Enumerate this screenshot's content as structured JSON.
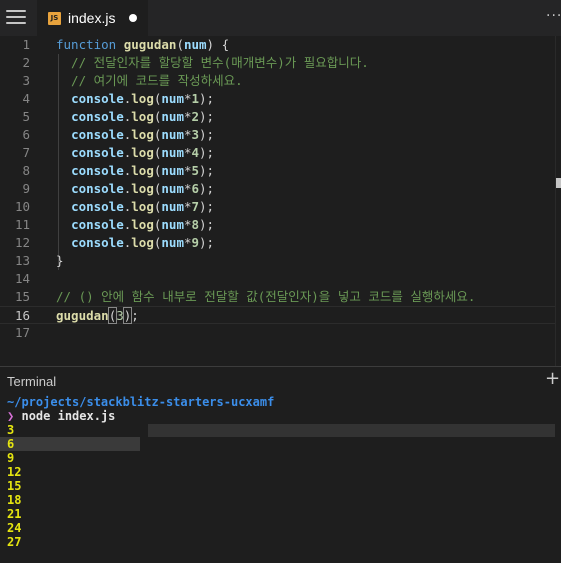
{
  "tab": {
    "filename": "index.js",
    "icon_label": "JS",
    "modified": true
  },
  "editor": {
    "lines": [
      {
        "n": "1",
        "tokens": [
          {
            "t": "function",
            "c": "kw"
          },
          {
            "t": " ",
            "c": "pl"
          },
          {
            "t": "gugudan",
            "c": "fn bold"
          },
          {
            "t": "(",
            "c": "pl"
          },
          {
            "t": "num",
            "c": "var bold"
          },
          {
            "t": ") {",
            "c": "pl"
          }
        ]
      },
      {
        "n": "2",
        "tokens": [
          {
            "t": "  // 전달인자를 할당할 변수(매개변수)가 필요합니다.",
            "c": "cmt"
          }
        ]
      },
      {
        "n": "3",
        "tokens": [
          {
            "t": "  // 여기에 코드를 작성하세요.",
            "c": "cmt"
          }
        ]
      },
      {
        "n": "4",
        "tokens": [
          {
            "t": "  ",
            "c": "pl"
          },
          {
            "t": "console",
            "c": "var bold"
          },
          {
            "t": ".",
            "c": "pl"
          },
          {
            "t": "log",
            "c": "fn bold"
          },
          {
            "t": "(",
            "c": "pl"
          },
          {
            "t": "num",
            "c": "var bold"
          },
          {
            "t": "*",
            "c": "pl"
          },
          {
            "t": "1",
            "c": "num bold"
          },
          {
            "t": ");",
            "c": "pl"
          }
        ]
      },
      {
        "n": "5",
        "tokens": [
          {
            "t": "  ",
            "c": "pl"
          },
          {
            "t": "console",
            "c": "var bold"
          },
          {
            "t": ".",
            "c": "pl"
          },
          {
            "t": "log",
            "c": "fn bold"
          },
          {
            "t": "(",
            "c": "pl"
          },
          {
            "t": "num",
            "c": "var bold"
          },
          {
            "t": "*",
            "c": "pl"
          },
          {
            "t": "2",
            "c": "num bold"
          },
          {
            "t": ");",
            "c": "pl"
          }
        ]
      },
      {
        "n": "6",
        "tokens": [
          {
            "t": "  ",
            "c": "pl"
          },
          {
            "t": "console",
            "c": "var bold"
          },
          {
            "t": ".",
            "c": "pl"
          },
          {
            "t": "log",
            "c": "fn bold"
          },
          {
            "t": "(",
            "c": "pl"
          },
          {
            "t": "num",
            "c": "var bold"
          },
          {
            "t": "*",
            "c": "pl"
          },
          {
            "t": "3",
            "c": "num bold"
          },
          {
            "t": ");",
            "c": "pl"
          }
        ]
      },
      {
        "n": "7",
        "tokens": [
          {
            "t": "  ",
            "c": "pl"
          },
          {
            "t": "console",
            "c": "var bold"
          },
          {
            "t": ".",
            "c": "pl"
          },
          {
            "t": "log",
            "c": "fn bold"
          },
          {
            "t": "(",
            "c": "pl"
          },
          {
            "t": "num",
            "c": "var bold"
          },
          {
            "t": "*",
            "c": "pl"
          },
          {
            "t": "4",
            "c": "num bold"
          },
          {
            "t": ");",
            "c": "pl"
          }
        ]
      },
      {
        "n": "8",
        "tokens": [
          {
            "t": "  ",
            "c": "pl"
          },
          {
            "t": "console",
            "c": "var bold"
          },
          {
            "t": ".",
            "c": "pl"
          },
          {
            "t": "log",
            "c": "fn bold"
          },
          {
            "t": "(",
            "c": "pl"
          },
          {
            "t": "num",
            "c": "var bold"
          },
          {
            "t": "*",
            "c": "pl"
          },
          {
            "t": "5",
            "c": "num bold"
          },
          {
            "t": ");",
            "c": "pl"
          }
        ]
      },
      {
        "n": "9",
        "tokens": [
          {
            "t": "  ",
            "c": "pl"
          },
          {
            "t": "console",
            "c": "var bold"
          },
          {
            "t": ".",
            "c": "pl"
          },
          {
            "t": "log",
            "c": "fn bold"
          },
          {
            "t": "(",
            "c": "pl"
          },
          {
            "t": "num",
            "c": "var bold"
          },
          {
            "t": "*",
            "c": "pl"
          },
          {
            "t": "6",
            "c": "num bold"
          },
          {
            "t": ");",
            "c": "pl"
          }
        ]
      },
      {
        "n": "10",
        "tokens": [
          {
            "t": "  ",
            "c": "pl"
          },
          {
            "t": "console",
            "c": "var bold"
          },
          {
            "t": ".",
            "c": "pl"
          },
          {
            "t": "log",
            "c": "fn bold"
          },
          {
            "t": "(",
            "c": "pl"
          },
          {
            "t": "num",
            "c": "var bold"
          },
          {
            "t": "*",
            "c": "pl"
          },
          {
            "t": "7",
            "c": "num bold"
          },
          {
            "t": ");",
            "c": "pl"
          }
        ]
      },
      {
        "n": "11",
        "tokens": [
          {
            "t": "  ",
            "c": "pl"
          },
          {
            "t": "console",
            "c": "var bold"
          },
          {
            "t": ".",
            "c": "pl"
          },
          {
            "t": "log",
            "c": "fn bold"
          },
          {
            "t": "(",
            "c": "pl"
          },
          {
            "t": "num",
            "c": "var bold"
          },
          {
            "t": "*",
            "c": "pl"
          },
          {
            "t": "8",
            "c": "num bold"
          },
          {
            "t": ");",
            "c": "pl"
          }
        ]
      },
      {
        "n": "12",
        "tokens": [
          {
            "t": "  ",
            "c": "pl"
          },
          {
            "t": "console",
            "c": "var bold"
          },
          {
            "t": ".",
            "c": "pl"
          },
          {
            "t": "log",
            "c": "fn bold"
          },
          {
            "t": "(",
            "c": "pl"
          },
          {
            "t": "num",
            "c": "var bold"
          },
          {
            "t": "*",
            "c": "pl"
          },
          {
            "t": "9",
            "c": "num bold"
          },
          {
            "t": ");",
            "c": "pl"
          }
        ]
      },
      {
        "n": "13",
        "tokens": [
          {
            "t": "}",
            "c": "pl"
          }
        ]
      },
      {
        "n": "14",
        "tokens": []
      },
      {
        "n": "15",
        "tokens": [
          {
            "t": "// () 안에 함수 내부로 전달할 값(전달인자)을 넣고 코드를 실행하세요.",
            "c": "cmt"
          }
        ]
      },
      {
        "n": "16",
        "active": true,
        "tokens": [
          {
            "t": "gugudan",
            "c": "fn bold"
          },
          {
            "t": "(",
            "c": "pl bracket-match"
          },
          {
            "t": "3",
            "c": "num"
          },
          {
            "t": ")",
            "c": "pl bracket-match"
          },
          {
            "t": ";",
            "c": "pl"
          }
        ]
      },
      {
        "n": "17",
        "tokens": []
      }
    ]
  },
  "terminal": {
    "title": "Terminal",
    "cwd": "~/projects/stackblitz-starters-ucxamf",
    "prompt_symbol": "❯",
    "command": "node index.js",
    "output": [
      "3",
      "6",
      "9",
      "12",
      "15",
      "18",
      "21",
      "24",
      "27"
    ]
  },
  "colors": {
    "background": "#1e1e1e",
    "tabbar": "#252526",
    "keyword": "#569cd6",
    "function": "#dcdcaa",
    "variable": "#9cdcfe",
    "number": "#b5cea8",
    "comment": "#6a9955",
    "terminal_path": "#3b8eea",
    "terminal_output": "#e5e510",
    "file_icon": "#e8a33d"
  },
  "icons": {
    "menu": "hamburger-menu-icon",
    "file": "javascript-file-icon",
    "more": "more-actions-icon",
    "new_terminal": "plus-icon"
  }
}
